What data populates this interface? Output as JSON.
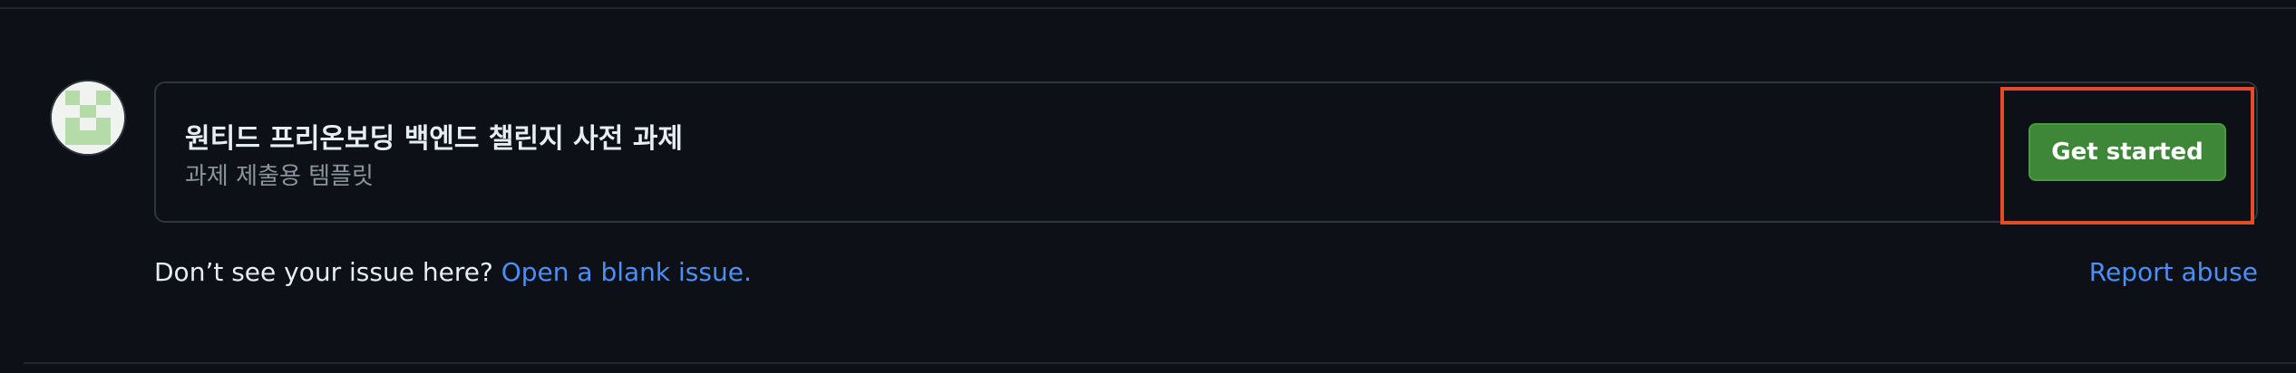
{
  "template": {
    "title": "원티드 프리온보딩 백엔드 챌린지 사전 과제",
    "description": "과제 제출용 템플릿",
    "button_label": "Get started"
  },
  "footer": {
    "prompt_text": "Don’t see your issue here?",
    "blank_issue_link": "Open a blank issue.",
    "report_abuse_link": "Report abuse"
  },
  "icons": {
    "avatar": "identicon-avatar"
  },
  "colors": {
    "background": "#0d1117",
    "card_border": "#30363d",
    "button": "#3f8738",
    "link": "#4d8ef7",
    "highlight": "#e34c2b",
    "identicon": "#b5dba8"
  }
}
